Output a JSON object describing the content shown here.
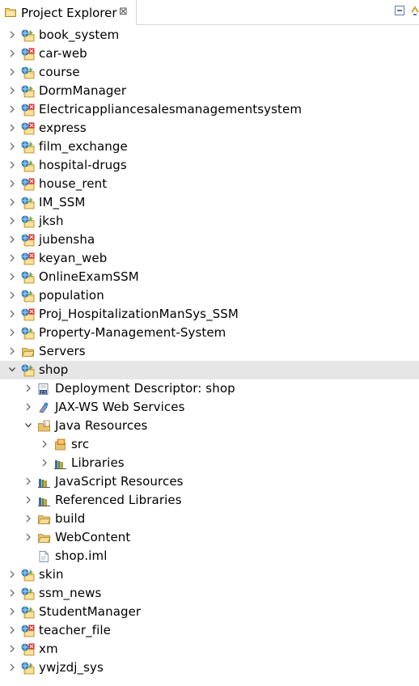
{
  "view": {
    "title": "Project Explorer",
    "close_glyph": "⊠",
    "toolbar": [
      "collapse-all-icon",
      "link-with-editor-icon"
    ]
  },
  "tree": [
    {
      "label": "book_system",
      "depth": 0,
      "expander": "collapsed",
      "icon": "web-project"
    },
    {
      "label": "car-web",
      "depth": 0,
      "expander": "collapsed",
      "icon": "web-project-error"
    },
    {
      "label": "course",
      "depth": 0,
      "expander": "collapsed",
      "icon": "web-project"
    },
    {
      "label": "DormManager",
      "depth": 0,
      "expander": "collapsed",
      "icon": "web-project"
    },
    {
      "label": "Electricappliancesalesmanagementsystem",
      "depth": 0,
      "expander": "collapsed",
      "icon": "web-project-error"
    },
    {
      "label": "express",
      "depth": 0,
      "expander": "collapsed",
      "icon": "web-project-error"
    },
    {
      "label": "film_exchange",
      "depth": 0,
      "expander": "collapsed",
      "icon": "web-project"
    },
    {
      "label": "hospital-drugs",
      "depth": 0,
      "expander": "collapsed",
      "icon": "web-project"
    },
    {
      "label": "house_rent",
      "depth": 0,
      "expander": "collapsed",
      "icon": "web-project-error"
    },
    {
      "label": "IM_SSM",
      "depth": 0,
      "expander": "collapsed",
      "icon": "web-project"
    },
    {
      "label": "jksh",
      "depth": 0,
      "expander": "collapsed",
      "icon": "web-project"
    },
    {
      "label": "jubensha",
      "depth": 0,
      "expander": "collapsed",
      "icon": "web-project-error"
    },
    {
      "label": "keyan_web",
      "depth": 0,
      "expander": "collapsed",
      "icon": "web-project-error"
    },
    {
      "label": "OnlineExamSSM",
      "depth": 0,
      "expander": "collapsed",
      "icon": "web-project"
    },
    {
      "label": "population",
      "depth": 0,
      "expander": "collapsed",
      "icon": "web-project"
    },
    {
      "label": "Proj_HospitalizationManSys_SSM",
      "depth": 0,
      "expander": "collapsed",
      "icon": "web-project-error"
    },
    {
      "label": "Property-Management-System",
      "depth": 0,
      "expander": "collapsed",
      "icon": "web-project"
    },
    {
      "label": "Servers",
      "depth": 0,
      "expander": "collapsed",
      "icon": "folder"
    },
    {
      "label": "shop",
      "depth": 0,
      "expander": "expanded",
      "icon": "web-project",
      "selected": true
    },
    {
      "label": "Deployment Descriptor: shop",
      "depth": 1,
      "expander": "collapsed",
      "icon": "deployment-descriptor"
    },
    {
      "label": "JAX-WS Web Services",
      "depth": 1,
      "expander": "collapsed",
      "icon": "web-services"
    },
    {
      "label": "Java Resources",
      "depth": 1,
      "expander": "expanded",
      "icon": "java-resources"
    },
    {
      "label": "src",
      "depth": 2,
      "expander": "collapsed",
      "icon": "source-folder"
    },
    {
      "label": "Libraries",
      "depth": 2,
      "expander": "collapsed",
      "icon": "libraries"
    },
    {
      "label": "JavaScript Resources",
      "depth": 1,
      "expander": "collapsed",
      "icon": "libraries"
    },
    {
      "label": "Referenced Libraries",
      "depth": 1,
      "expander": "collapsed",
      "icon": "libraries"
    },
    {
      "label": "build",
      "depth": 1,
      "expander": "collapsed",
      "icon": "folder"
    },
    {
      "label": "WebContent",
      "depth": 1,
      "expander": "collapsed",
      "icon": "folder"
    },
    {
      "label": "shop.iml",
      "depth": 1,
      "expander": "none",
      "icon": "file"
    },
    {
      "label": "skin",
      "depth": 0,
      "expander": "collapsed",
      "icon": "web-project"
    },
    {
      "label": "ssm_news",
      "depth": 0,
      "expander": "collapsed",
      "icon": "web-project"
    },
    {
      "label": "StudentManager",
      "depth": 0,
      "expander": "collapsed",
      "icon": "web-project"
    },
    {
      "label": "teacher_file",
      "depth": 0,
      "expander": "collapsed",
      "icon": "web-project-error"
    },
    {
      "label": "xm",
      "depth": 0,
      "expander": "collapsed",
      "icon": "web-project-error"
    },
    {
      "label": "ywjzdj_sys",
      "depth": 0,
      "expander": "collapsed",
      "icon": "web-project"
    }
  ],
  "colors": {
    "selection": "#e6e6e6",
    "folder": "#e8c36a",
    "error_badge": "#d62c2c",
    "globe": "#3a8fd4"
  }
}
